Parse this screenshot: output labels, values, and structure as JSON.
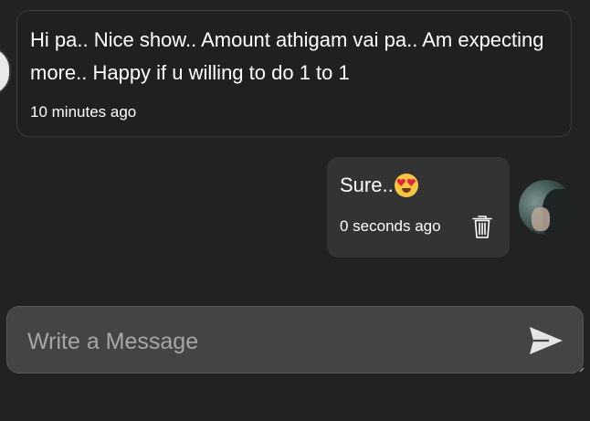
{
  "conversation": {
    "incoming": {
      "text": "Hi pa.. Nice show.. Amount athigam vai pa.. Am expecting more.. Happy if u willing to do 1 to 1",
      "time": "10 minutes ago"
    },
    "outgoing": {
      "text": "Sure..",
      "emoji_icon": "heart-eyes-emoji-icon",
      "time": "0 seconds ago",
      "delete_icon": "trash-icon"
    }
  },
  "composer": {
    "placeholder": "Write a Message",
    "value": "",
    "send_icon": "send-icon"
  },
  "colors": {
    "background": "#222222",
    "incoming_border": "#3c3c3c",
    "outgoing_bubble": "#333333",
    "composer_bg": "#444444",
    "text": "#ffffff",
    "placeholder": "#a6a6a6"
  }
}
